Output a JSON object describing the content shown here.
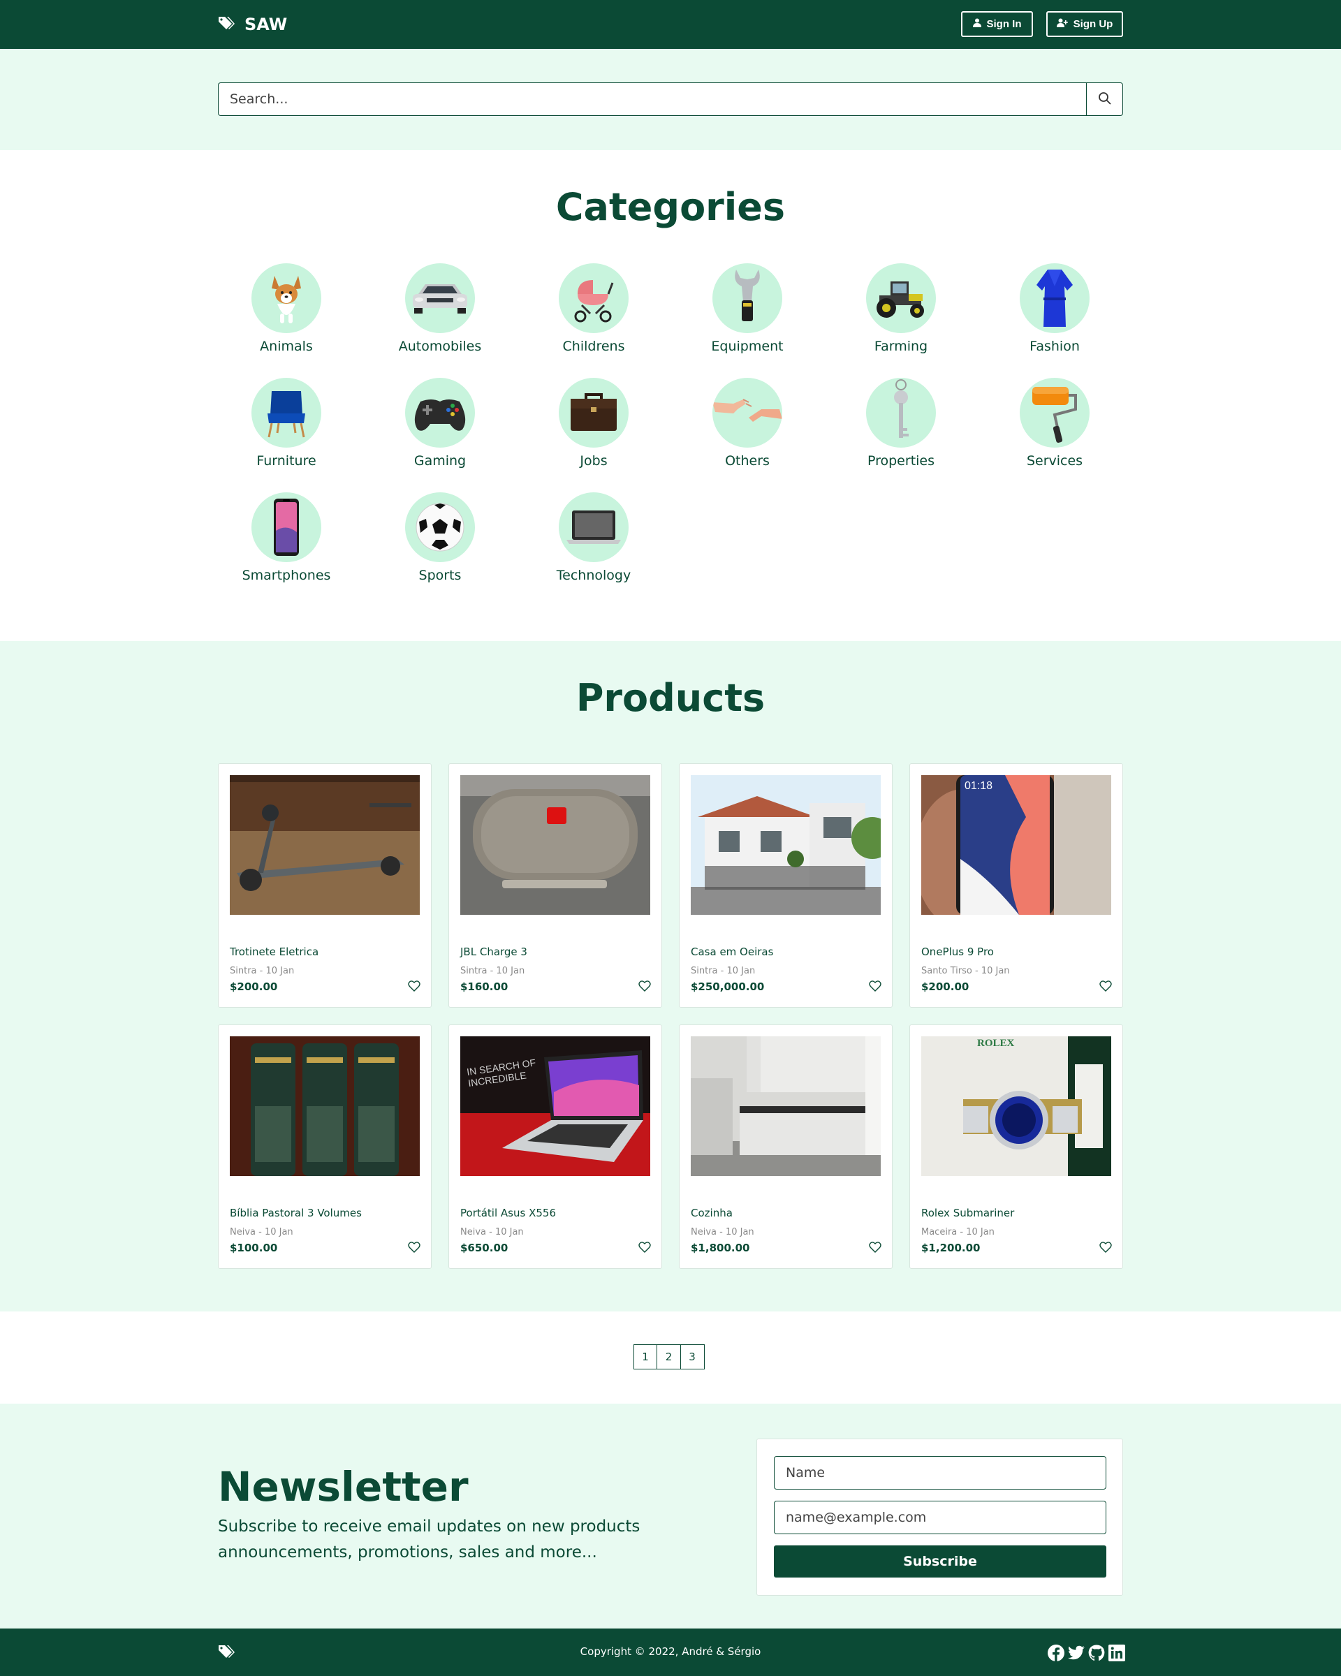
{
  "brand": {
    "name": "SAW",
    "icon": "tags-icon"
  },
  "nav": {
    "signin_label": "Sign In",
    "signup_label": "Sign Up"
  },
  "search": {
    "placeholder": "Search...",
    "icon": "search-icon"
  },
  "categories": {
    "title": "Categories",
    "items": [
      {
        "label": "Animals"
      },
      {
        "label": "Automobiles"
      },
      {
        "label": "Childrens"
      },
      {
        "label": "Equipment"
      },
      {
        "label": "Farming"
      },
      {
        "label": "Fashion"
      },
      {
        "label": "Furniture"
      },
      {
        "label": "Gaming"
      },
      {
        "label": "Jobs"
      },
      {
        "label": "Others"
      },
      {
        "label": "Properties"
      },
      {
        "label": "Services"
      },
      {
        "label": "Smartphones"
      },
      {
        "label": "Sports"
      },
      {
        "label": "Technology"
      }
    ]
  },
  "products": {
    "title": "Products",
    "items": [
      {
        "name": "Trotinete Eletrica",
        "meta": "Sintra - 10 Jan",
        "price": "$200.00"
      },
      {
        "name": "JBL Charge 3",
        "meta": "Sintra - 10 Jan",
        "price": "$160.00"
      },
      {
        "name": "Casa em Oeiras",
        "meta": "Sintra - 10 Jan",
        "price": "$250,000.00"
      },
      {
        "name": "OnePlus 9 Pro",
        "meta": "Santo Tirso - 10 Jan",
        "price": "$200.00"
      },
      {
        "name": "Bíblia Pastoral 3 Volumes",
        "meta": "Neiva - 10 Jan",
        "price": "$100.00"
      },
      {
        "name": "Portátil Asus X556",
        "meta": "Neiva - 10 Jan",
        "price": "$650.00"
      },
      {
        "name": "Cozinha",
        "meta": "Neiva - 10 Jan",
        "price": "$1,800.00"
      },
      {
        "name": "Rolex Submariner",
        "meta": "Maceira - 10 Jan",
        "price": "$1,200.00"
      }
    ]
  },
  "pagination": {
    "pages": [
      "1",
      "2",
      "3"
    ]
  },
  "newsletter": {
    "title": "Newsletter",
    "text": "Subscribe to receive email updates on new products announcements, promotions, sales and more...",
    "name_placeholder": "Name",
    "email_placeholder": "name@example.com",
    "submit_label": "Subscribe"
  },
  "footer": {
    "copyright": "Copyright © 2022, André & Sérgio",
    "socials": [
      "facebook-icon",
      "twitter-icon",
      "github-icon",
      "linkedin-icon"
    ]
  },
  "colors": {
    "primary": "#0b4a35",
    "band": "#e8faf1",
    "circle": "#c8f4dd"
  }
}
